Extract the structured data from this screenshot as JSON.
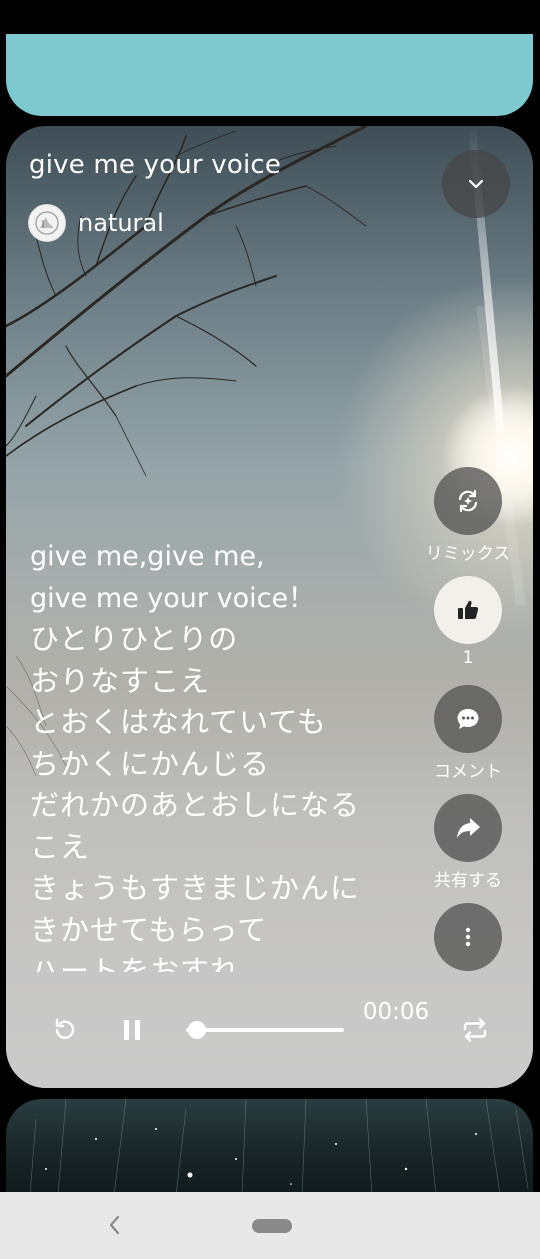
{
  "song": {
    "title": "give me your voice",
    "artist": "natural"
  },
  "lyrics": [
    "give me,give me,",
    "give me your voice！",
    "ひとりひとりの",
    "おりなすこえ",
    "とおくはなれていても",
    "ちかくにかんじる",
    "だれかのあとおしになる",
    "こえ",
    "きょうもすきまじかんに",
    "きかせてもらって",
    "ハートをおすれ"
  ],
  "actions": {
    "remix_label": "リミックス",
    "like_count": "1",
    "comment_label": "コメント",
    "share_label": "共有する"
  },
  "player": {
    "time": "00:06",
    "progress": 0.07
  },
  "icons": {
    "collapse": "chevron-down-icon",
    "remix": "remix-icon",
    "like": "thumbs-up-icon",
    "comment": "comment-icon",
    "share": "share-icon",
    "more": "more-vertical-icon",
    "replay": "replay-icon",
    "pause": "pause-icon",
    "repeat": "repeat-icon",
    "back": "back-icon"
  },
  "colors": {
    "prev_card": "#7ec8cf",
    "like_button": "#f3efea",
    "navbar": "#e8e8e8"
  }
}
